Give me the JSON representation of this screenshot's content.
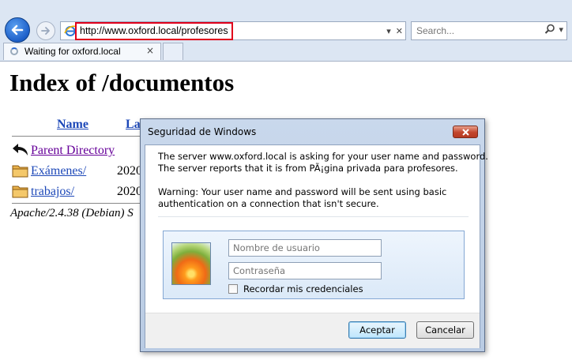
{
  "browser": {
    "url": "http://www.oxford.local/profesores",
    "search_placeholder": "Search...",
    "tab_label": "Waiting for oxford.local",
    "tab_close": "×"
  },
  "page": {
    "title": "Index of /documentos",
    "columns": {
      "name": "Name",
      "last_modified": "La"
    },
    "rows": [
      {
        "icon": "back-arrow-icon",
        "name": "Parent Directory",
        "date": ""
      },
      {
        "icon": "folder-icon",
        "name": "Exámenes/",
        "date": "2020"
      },
      {
        "icon": "folder-icon",
        "name": "trabajos/",
        "date": "2020"
      }
    ],
    "footer": "Apache/2.4.38 (Debian) S"
  },
  "dialog": {
    "title": "Seguridad de Windows",
    "message_lines": [
      "The server www.oxford.local is asking for your user name and password.",
      "The server reports that it is from PÃ¡gina privada para profesores."
    ],
    "warning_lines": [
      "Warning: Your user name and password will be sent using basic",
      "authentication on a connection that isn't secure."
    ],
    "username_placeholder": "Nombre de usuario",
    "password_placeholder": "Contraseña",
    "remember_label": "Recordar mis credenciales",
    "remember_checked": false,
    "accept_label": "Aceptar",
    "cancel_label": "Cancelar"
  },
  "colors": {
    "chrome_bg": "#dce6f3",
    "link": "#1d48b8",
    "visited_link": "#660099",
    "url_highlight": "#e0001b"
  }
}
